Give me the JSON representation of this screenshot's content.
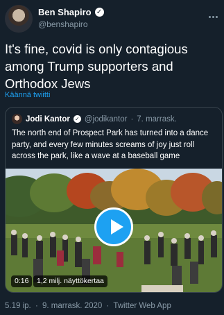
{
  "tweet": {
    "author_name": "Ben Shapiro",
    "author_handle": "@benshapiro",
    "text": "It's fine, covid is only contagious among Trump supporters and Orthodox Jews",
    "translate_label": "Käännä twiitti"
  },
  "quoted_tweet": {
    "author_name": "Jodi Kantor",
    "author_handle": "@jodikantor",
    "separator": "·",
    "date": "7. marrask.",
    "text": "The north end of Prospect Park has turned into a dance party, and every few minutes screams of joy just roll across the park, like a wave at a baseball game",
    "video": {
      "duration": "0:16",
      "views": "1,2 milj. näyttökertaa"
    }
  },
  "footer": {
    "time": "5.19 ip.",
    "separator": "·",
    "date": "9. marrask. 2020",
    "separator2": "·",
    "source": "Twitter Web App"
  },
  "icons": {
    "verified": "verified-check-icon",
    "more": "more-options-icon",
    "play": "play-icon"
  },
  "colors": {
    "background": "#15202b",
    "accent": "#1da1f2",
    "secondary_text": "#8899a6",
    "border": "#38444d"
  }
}
